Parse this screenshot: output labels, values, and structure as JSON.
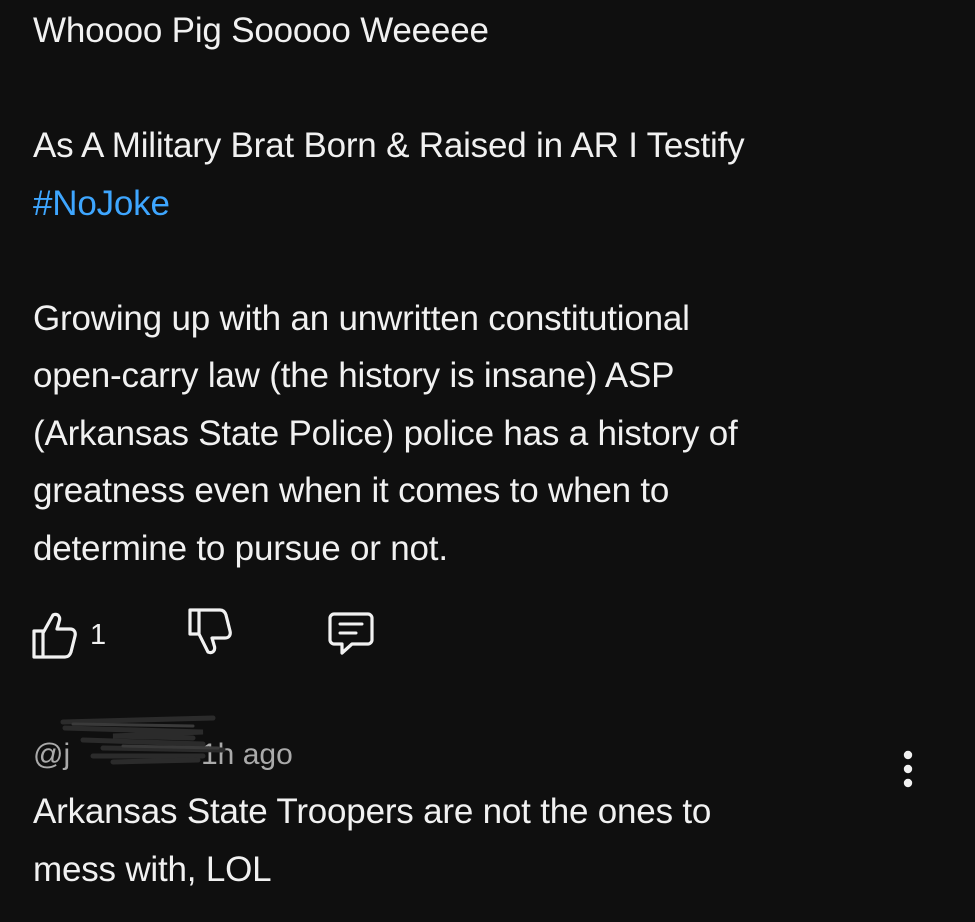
{
  "comment": {
    "line1": "Whoooo Pig Sooooo Weeeee",
    "line2": "As A Military Brat Born & Raised in AR I Testify",
    "hashtag": "#NoJoke",
    "p1": "Growing up with an unwritten constitutional",
    "p2": "open-carry law (the history is insane) ASP",
    "p3": "(Arkansas State Police) police has a history of",
    "p4": "greatness even when it comes to when to",
    "p5": "determine to pursue or not."
  },
  "actions": {
    "like_count": "1",
    "like_icon": "thumbs-up-icon",
    "dislike_icon": "thumbs-down-icon",
    "reply_icon": "reply-comment-icon"
  },
  "reply": {
    "handle": "@j",
    "time": "1h ago",
    "text_line1": "Arkansas State Troopers are not the ones to",
    "text_line2": "mess with, LOL",
    "more_icon": "more-vertical-icon"
  },
  "colors": {
    "background": "#0f0f0f",
    "text": "#f1f1f1",
    "secondary": "#aaaaaa",
    "hashtag": "#3ea6ff"
  }
}
